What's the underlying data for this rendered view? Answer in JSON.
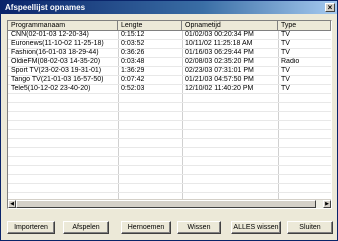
{
  "window": {
    "title": "Afspeellijst opnames",
    "close_label": "×"
  },
  "columns": [
    "Programmanaam",
    "Lengte",
    "Opnametijd",
    "Type"
  ],
  "rows": [
    [
      "CNN(02-01-03 12-20-34)",
      "0:15:12",
      "01/02/03 00:20:34 PM",
      "TV"
    ],
    [
      "Euronews(11-10-02 11-25-18)",
      "0:03:52",
      "10/11/02 11:25:18 AM",
      "TV"
    ],
    [
      "Fashion(16-01-03 18-29-44)",
      "0:36:26",
      "01/16/03 06:29:44 PM",
      "TV"
    ],
    [
      "OldieFM(08-02-03 14-35-20)",
      "0:03:48",
      "02/08/03 02:35:20 PM",
      "Radio"
    ],
    [
      "Sport TV(23-02-03 19-31-01)",
      "1:36:29",
      "02/23/03 07:31:01 PM",
      "TV"
    ],
    [
      "Tango TV(21-01-03 16-57-50)",
      "0:07:42",
      "01/21/03 04:57:50 PM",
      "TV"
    ],
    [
      "Tele5(10-12-02 23-40-20)",
      "0:52:03",
      "12/10/02 11:40:20 PM",
      "TV"
    ]
  ],
  "scroll": {
    "left_arrow": "◀",
    "right_arrow": "▶"
  },
  "buttons": {
    "importeren": "Importeren",
    "afspelen": "Afspelen",
    "hernoemen": "Hernoemen",
    "wissen": "Wissen",
    "alles_wissen": "ALLES wissen",
    "sluiten": "Sluiten"
  }
}
